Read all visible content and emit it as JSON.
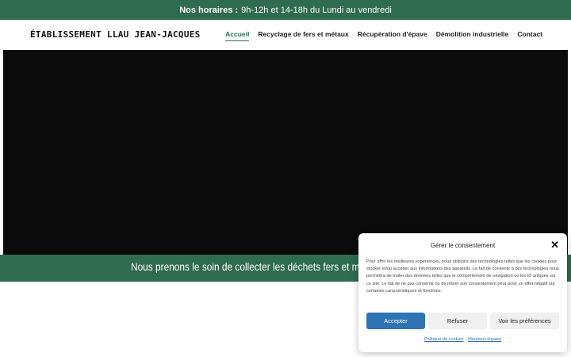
{
  "topbar": {
    "hours_label": "Nos horaires :",
    "hours_text": "9h-12h et 14-18h du Lundi au vendredi"
  },
  "header": {
    "logo": "Établissement Llau Jean-Jacques",
    "nav": [
      "Accueil",
      "Recyclage de fers et métaux",
      "Récupération d'épave",
      "Démolition industrielle",
      "Contact"
    ]
  },
  "banner": {
    "text": "Nous prenons le soin de collecter les déchets fers et métaux"
  },
  "cookie": {
    "title": "Gérer le consentement",
    "close_icon": "close-icon",
    "body": "Pour offrir les meilleures expériences, nous utilisons des technologies telles que les cookies pour stocker et/ou accéder aux informations des appareils. Le fait de consentir à ces technologies nous permettra de traiter des données telles que le comportement de navigation ou les ID uniques sur ce site. Le fait de ne pas consentir ou de retirer son consentement peut avoir un effet négatif sur certaines caractéristiques et fonctions.",
    "accept": "Accepter",
    "refuse": "Refuser",
    "preferences": "Voir les préférences",
    "cookie_policy": "Politique de cookies",
    "legal": "Mentions légales"
  },
  "colors": {
    "brand_green": "#2e6b4f",
    "accept_blue": "#2e74b5",
    "video_bg": "#0b0b0b"
  }
}
